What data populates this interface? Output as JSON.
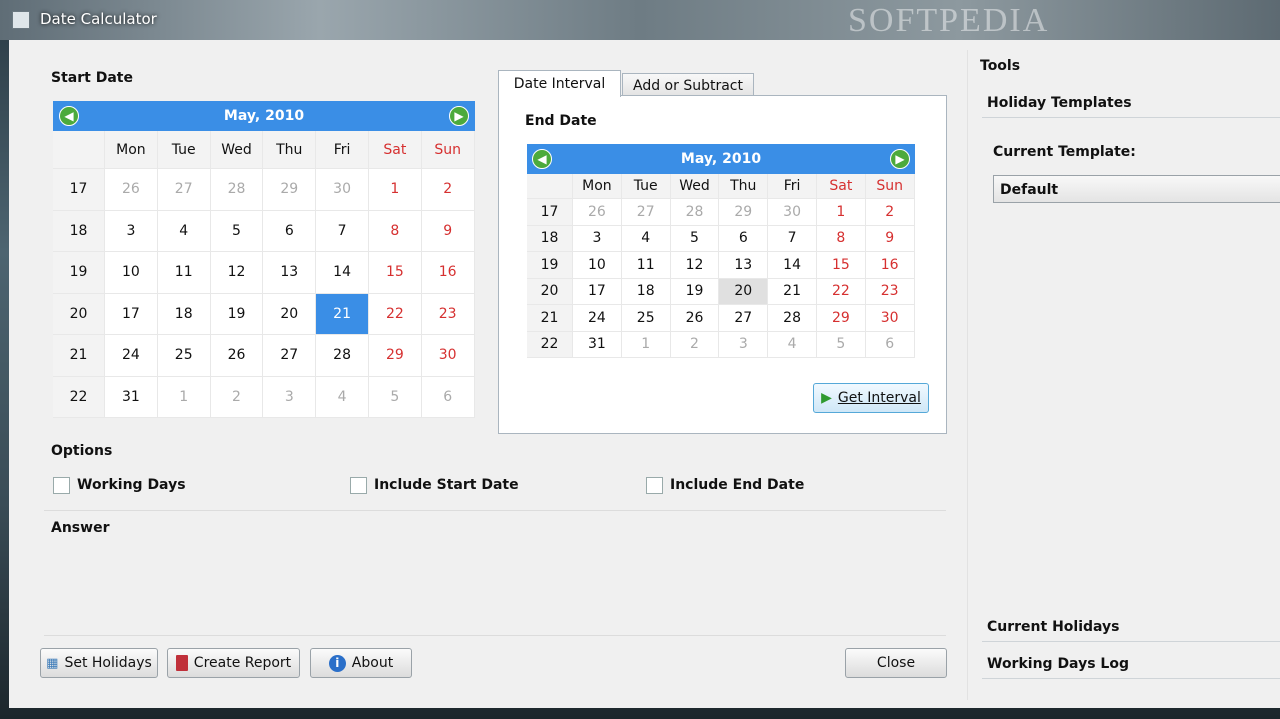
{
  "window": {
    "title": "Date Calculator",
    "watermark": "SOFTPEDIA"
  },
  "start_date": {
    "label": "Start Date",
    "month_label": "May,   2010",
    "day_headers": [
      "Mon",
      "Tue",
      "Wed",
      "Thu",
      "Fri",
      "Sat",
      "Sun"
    ],
    "weeks": [
      {
        "wk": "17",
        "days": [
          "26",
          "27",
          "28",
          "29",
          "30",
          "1",
          "2"
        ]
      },
      {
        "wk": "18",
        "days": [
          "3",
          "4",
          "5",
          "6",
          "7",
          "8",
          "9"
        ]
      },
      {
        "wk": "19",
        "days": [
          "10",
          "11",
          "12",
          "13",
          "14",
          "15",
          "16"
        ]
      },
      {
        "wk": "20",
        "days": [
          "17",
          "18",
          "19",
          "20",
          "21",
          "22",
          "23"
        ]
      },
      {
        "wk": "21",
        "days": [
          "24",
          "25",
          "26",
          "27",
          "28",
          "29",
          "30"
        ]
      },
      {
        "wk": "22",
        "days": [
          "31",
          "1",
          "2",
          "3",
          "4",
          "5",
          "6"
        ]
      }
    ],
    "selected_day": "21"
  },
  "tabs": {
    "items": [
      "Date Interval",
      "Add or Subtract"
    ],
    "active": "Date Interval"
  },
  "end_date": {
    "label": "End Date",
    "month_label": "May,   2010",
    "day_headers": [
      "Mon",
      "Tue",
      "Wed",
      "Thu",
      "Fri",
      "Sat",
      "Sun"
    ],
    "weeks": [
      {
        "wk": "17",
        "days": [
          "26",
          "27",
          "28",
          "29",
          "30",
          "1",
          "2"
        ]
      },
      {
        "wk": "18",
        "days": [
          "3",
          "4",
          "5",
          "6",
          "7",
          "8",
          "9"
        ]
      },
      {
        "wk": "19",
        "days": [
          "10",
          "11",
          "12",
          "13",
          "14",
          "15",
          "16"
        ]
      },
      {
        "wk": "20",
        "days": [
          "17",
          "18",
          "19",
          "20",
          "21",
          "22",
          "23"
        ]
      },
      {
        "wk": "21",
        "days": [
          "24",
          "25",
          "26",
          "27",
          "28",
          "29",
          "30"
        ]
      },
      {
        "wk": "22",
        "days": [
          "31",
          "1",
          "2",
          "3",
          "4",
          "5",
          "6"
        ]
      }
    ],
    "highlighted_day": "20"
  },
  "get_interval_label": "Get Interval",
  "options": {
    "label": "Options",
    "items": [
      {
        "label": "Working Days",
        "checked": false
      },
      {
        "label": "Include Start Date",
        "checked": false
      },
      {
        "label": "Include End Date",
        "checked": false
      }
    ]
  },
  "answer": {
    "label": "Answer"
  },
  "buttons": {
    "set_holidays": "Set Holidays",
    "create_report": "Create Report",
    "about": "About",
    "close": "Close"
  },
  "tools": {
    "label": "Tools",
    "holiday_templates": "Holiday Templates",
    "current_template_label": "Current Template:",
    "current_template_value": "Default",
    "current_holidays": "Current Holidays",
    "working_days_log": "Working Days Log"
  },
  "colors": {
    "accent": "#3a8ee6",
    "weekend": "#d63030",
    "dim": "#aaaaaa"
  }
}
